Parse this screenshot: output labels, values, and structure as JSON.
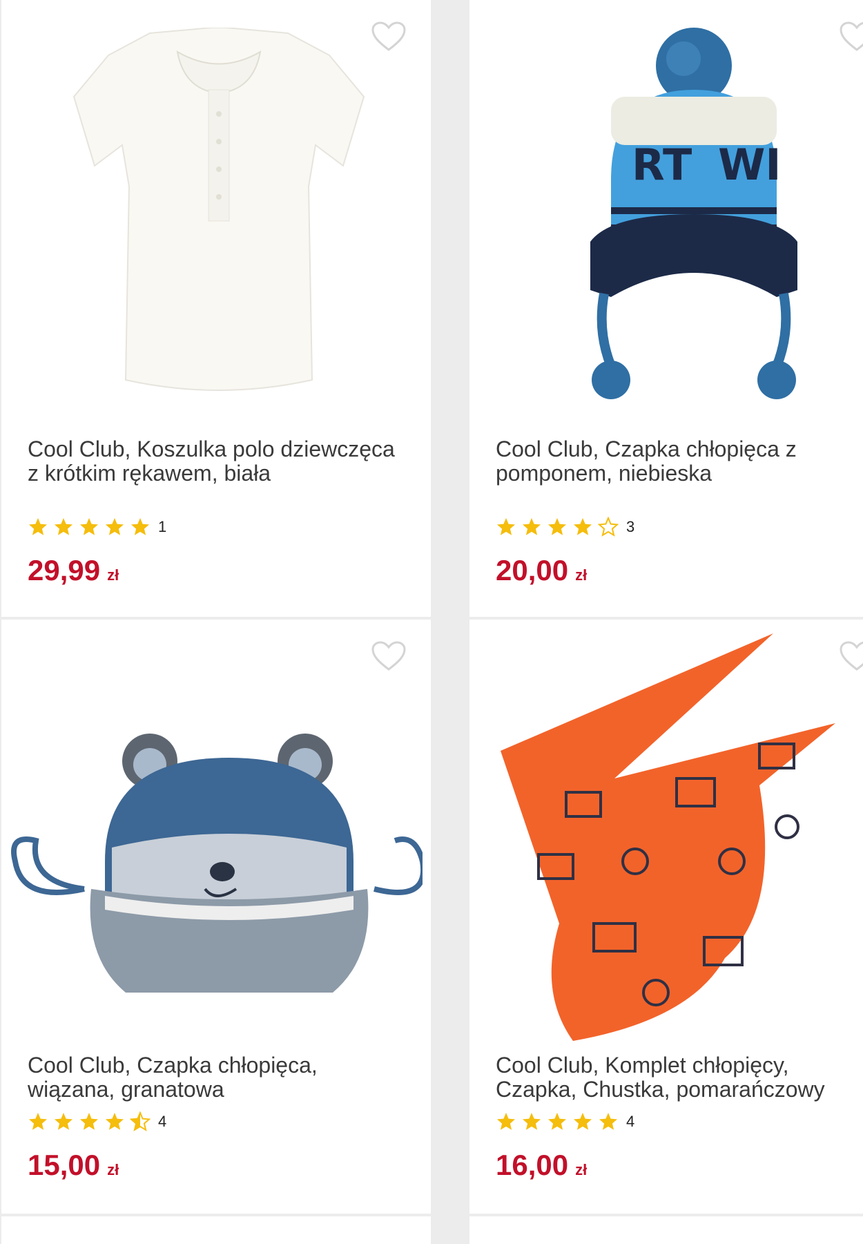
{
  "products": [
    {
      "title": "Cool Club, Koszulka polo dziewczęca z krótkim rękawem, biała",
      "rating_count": "1",
      "stars": 5,
      "price": "29,99",
      "currency": "zł"
    },
    {
      "title": "Cool Club, Czapka chłopięca z pomponem, niebieska",
      "rating_count": "3",
      "stars": 4,
      "price": "20,00",
      "currency": "zł"
    },
    {
      "title": "Cool Club, Czapka chłopięca, wiązana, granatowa",
      "rating_count": "4",
      "stars": 4.5,
      "price": "15,00",
      "currency": "zł"
    },
    {
      "title": "Cool Club, Komplet chłopięcy, Czapka, Chustka, pomarańczowy",
      "rating_count": "4",
      "stars": 5,
      "price": "16,00",
      "currency": "zł"
    }
  ],
  "colors": {
    "price": "#c2102a",
    "star": "#f5bd0c",
    "background": "#ececec"
  },
  "icons": {
    "favorite": "heart-outline-icon",
    "rating": "star-icon"
  }
}
